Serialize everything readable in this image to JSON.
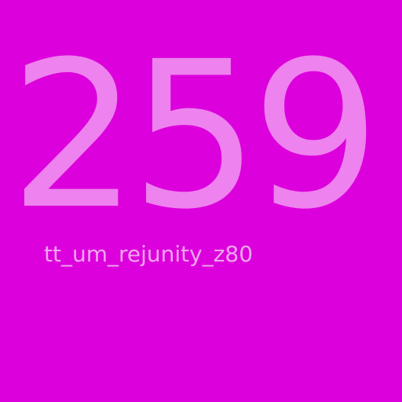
{
  "screen": {
    "background_color": "#dc00dc",
    "number": "259",
    "number_color": "#ee82ee",
    "caption": "tt_um_rejunity_z80",
    "caption_color": "#f0a6ee"
  }
}
